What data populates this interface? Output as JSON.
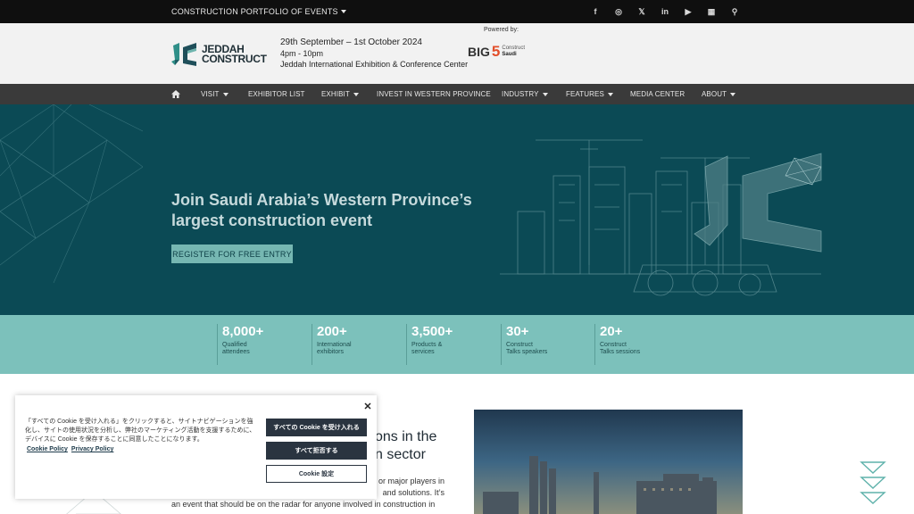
{
  "topbar": {
    "portfolio_label": "CONSTRUCTION PORTFOLIO OF EVENTS",
    "socials": [
      {
        "icon": "facebook-icon",
        "glyph": "f"
      },
      {
        "icon": "instagram-icon",
        "glyph": "◎"
      },
      {
        "icon": "x-icon",
        "glyph": "𝕏"
      },
      {
        "icon": "linkedin-icon",
        "glyph": "in"
      },
      {
        "icon": "youtube-icon",
        "glyph": "▶"
      },
      {
        "icon": "calendar-icon",
        "glyph": "▦"
      },
      {
        "icon": "search-icon",
        "glyph": "⚲"
      }
    ]
  },
  "header": {
    "logo_line1": "JEDDAH",
    "logo_line2": "CONSTRUCT",
    "dates": "29th September – 1st October 2024",
    "hours": "4pm - 10pm",
    "venue": "Jeddah International Exhibition & Conference Center",
    "powered_by": "Powered by:",
    "big5_big": "BIG",
    "big5_five": "5",
    "big5_line1": "Construct",
    "big5_line2": "Saudi"
  },
  "nav": {
    "items": [
      {
        "label": "VISIT",
        "dropdown": true
      },
      {
        "label": "EXHIBITOR LIST",
        "dropdown": false
      },
      {
        "label": "EXHIBIT",
        "dropdown": true
      },
      {
        "label": "INVEST IN WESTERN PROVINCE",
        "dropdown": false
      },
      {
        "label": "INDUSTRY",
        "dropdown": true
      },
      {
        "label": "FEATURES",
        "dropdown": true
      },
      {
        "label": "MEDIA CENTER",
        "dropdown": false
      },
      {
        "label": "ABOUT",
        "dropdown": true
      }
    ]
  },
  "hero": {
    "title_line1": "Join Saudi Arabia’s Western Province’s",
    "title_line2": "largest construction event",
    "register_label": "REGISTER FOR FREE ENTRY"
  },
  "stats": [
    {
      "num": "8,000+",
      "l1": "Qualified",
      "l2": "attendees"
    },
    {
      "num": "200+",
      "l1": "International",
      "l2": "exhibitors"
    },
    {
      "num": "3,500+",
      "l1": "Products &",
      "l2": "services"
    },
    {
      "num": "30+",
      "l1": "Construct",
      "l2": "Talks speakers"
    },
    {
      "num": "20+",
      "l1": "Construct",
      "l2": "Talks sessions"
    }
  ],
  "content": {
    "heading_line1": "ons in the",
    "heading_line2": "n sector",
    "p_line1": "or major players in",
    "p_line2": "and solutions. It’s",
    "p_line3": "an event that should be on the radar for anyone involved in construction in"
  },
  "cookie": {
    "text": "「すべての Cookie を受け入れる」をクリックすると、サイトナビゲーションを強化し、サイトの使用状況を分析し、弊社のマーケティング活動を支援するために、デバイスに Cookie を保存することに同意したことになります。",
    "cookie_policy": "Cookie Policy",
    "privacy_policy": "Privacy Policy",
    "accept_all": "すべての Cookie を受け入れる",
    "reject_all": "すべて拒否する",
    "settings": "Cookie 設定",
    "close_glyph": "✕"
  },
  "colors": {
    "hero_bg": "#0b4a55",
    "stats_bg": "#7cc1bb",
    "nav_bg": "#3a3a3a",
    "accent": "#76b7b2"
  }
}
